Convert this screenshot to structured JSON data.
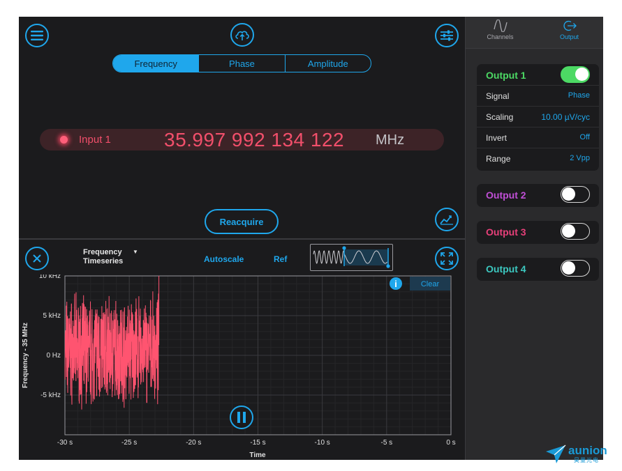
{
  "top": {
    "tabs": [
      "Frequency",
      "Phase",
      "Amplitude"
    ],
    "active_tab": 0,
    "input_label": "Input 1",
    "frequency_value": "35.997 992 134 122",
    "frequency_unit": "MHz",
    "reacquire_label": "Reacquire"
  },
  "bottom": {
    "plot_type_line1": "Frequency",
    "plot_type_line2": "Timeseries",
    "autoscale_label": "Autoscale",
    "ref_label": "Ref",
    "clear_label": "Clear",
    "info_glyph": "i"
  },
  "chart_data": {
    "type": "line",
    "xlabel": "Time",
    "ylabel": "Frequency - 35 MHz",
    "x_ticks": [
      "-30 s",
      "-25 s",
      "-20 s",
      "-15 s",
      "-10 s",
      "-5 s",
      "0 s"
    ],
    "y_ticks": [
      "10 kHz",
      "5 kHz",
      "0 Hz",
      "-5 kHz"
    ],
    "xlim": [
      -30,
      0
    ],
    "ylim": [
      -10,
      10
    ],
    "x_unit": "s",
    "y_unit": "kHz",
    "series": [
      {
        "color": "#ff5470",
        "x_start": -30,
        "x_end": -22.7,
        "y_mean": 0.6,
        "y_min": -7.5,
        "y_max": 10,
        "description_range": "noisy signal between roughly -7.5 kHz and 10 kHz"
      }
    ],
    "grid": true
  },
  "sidebar": {
    "tabs": [
      {
        "label": "Channels",
        "icon": "sine-wave-icon"
      },
      {
        "label": "Output",
        "icon": "output-arrow-icon"
      }
    ],
    "active_tab": 1,
    "outputs": [
      {
        "title": "Output 1",
        "color": "#4cd964",
        "enabled": true,
        "rows": [
          {
            "key": "Signal",
            "value": "Phase"
          },
          {
            "key": "Scaling",
            "value": "10.00 µV/cyc"
          },
          {
            "key": "Invert",
            "value": "Off"
          },
          {
            "key": "Range",
            "value": "2 Vpp"
          }
        ]
      },
      {
        "title": "Output 2",
        "color": "#c04fd6",
        "enabled": false
      },
      {
        "title": "Output 3",
        "color": "#e8407a",
        "enabled": false
      },
      {
        "title": "Output 4",
        "color": "#3cc8c0",
        "enabled": false
      }
    ]
  },
  "logo": {
    "text": "aunion",
    "subtext": "昊量光电"
  },
  "colors": {
    "accent": "#1fa7ec",
    "trace": "#ff5470",
    "background": "#1b1b1d"
  }
}
